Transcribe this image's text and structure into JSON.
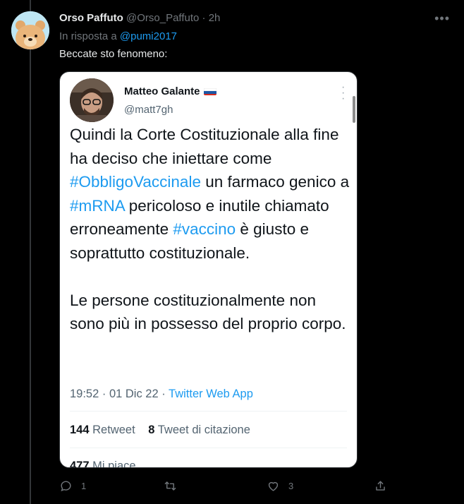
{
  "tweet": {
    "author_name": "Orso Paffuto",
    "author_handle": "@Orso_Paffuto",
    "separator": "·",
    "time": "2h",
    "reply_prefix": "In risposta a",
    "reply_mention": "@pumi2017",
    "text": "Beccate sto fenomeno:",
    "avatar_icon": "bear-avatar-icon"
  },
  "embedded_screenshot": {
    "author_name": "Matteo Galante",
    "flag_icon": "russian-flag-icon",
    "author_handle": "@matt7gh",
    "body_p1": [
      {
        "text": "Quindi la Corte Costituzionale alla fine ha deciso che iniettare come ",
        "hashtag": false
      },
      {
        "text": "#ObbligoVaccinale",
        "hashtag": true
      },
      {
        "text": " un farmaco genico a ",
        "hashtag": false
      },
      {
        "text": "#mRNA",
        "hashtag": true
      },
      {
        "text": " pericoloso e inutile chiamato erroneamente ",
        "hashtag": false
      },
      {
        "text": "#vaccino",
        "hashtag": true
      },
      {
        "text": " è giusto e soprattutto costituzionale.",
        "hashtag": false
      }
    ],
    "body_p2": "Le persone costituzionalmente non sono più in possesso del proprio corpo.",
    "timestamp": "19:52 · 01 Dic 22 · ",
    "source": "Twitter Web App",
    "retweets_count": "144",
    "retweets_label": "Retweet",
    "quotes_count": "8",
    "quotes_label": "Tweet di citazione",
    "likes_count": "477",
    "likes_label": "Mi piace"
  },
  "actions": {
    "reply_count": "1",
    "retweet_count": "",
    "like_count": "3"
  },
  "colors": {
    "background": "#000000",
    "link": "#1d9bf0",
    "muted": "#71767b",
    "text": "#e7e9ea"
  }
}
